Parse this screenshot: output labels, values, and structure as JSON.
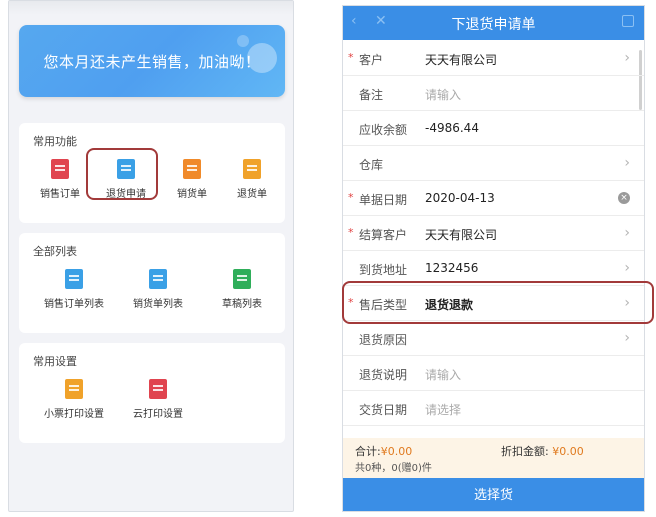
{
  "left": {
    "banner_text": "您本月还未产生销售，加油呦！",
    "sections": {
      "common_functions": {
        "title": "常用功能",
        "items": [
          {
            "label": "销售订单",
            "color": "#e0444f"
          },
          {
            "label": "退货申请",
            "color": "#3aa0e6"
          },
          {
            "label": "销货单",
            "color": "#f08a2a"
          },
          {
            "label": "退货单",
            "color": "#f0a22a"
          }
        ]
      },
      "all_lists": {
        "title": "全部列表",
        "items": [
          {
            "label": "销售订单列表",
            "color": "#3aa0e6"
          },
          {
            "label": "销货单列表",
            "color": "#3aa0e6"
          },
          {
            "label": "草稿列表",
            "color": "#2fae5a"
          }
        ]
      },
      "common_settings": {
        "title": "常用设置",
        "items": [
          {
            "label": "小票打印设置",
            "color": "#f0a22a"
          },
          {
            "label": "云打印设置",
            "color": "#e0444f"
          }
        ]
      }
    }
  },
  "right": {
    "header_title": "下退货申请单",
    "rows": [
      {
        "label": "客户",
        "value": "天天有限公司",
        "required": true,
        "placeholder": false,
        "trailing": "chevron"
      },
      {
        "label": "备注",
        "value": "请输入",
        "required": false,
        "placeholder": true,
        "trailing": ""
      },
      {
        "label": "应收余额",
        "value": "-4986.44",
        "required": false,
        "placeholder": false,
        "trailing": ""
      },
      {
        "label": "仓库",
        "value": "",
        "required": false,
        "placeholder": false,
        "trailing": "chevron"
      },
      {
        "label": "单据日期",
        "value": "2020-04-13",
        "required": true,
        "placeholder": false,
        "trailing": "clear"
      },
      {
        "label": "结算客户",
        "value": "天天有限公司",
        "required": true,
        "placeholder": false,
        "trailing": "chevron"
      },
      {
        "label": "到货地址",
        "value": "1232456",
        "required": false,
        "placeholder": false,
        "trailing": "chevron"
      },
      {
        "label": "售后类型",
        "value": "退货退款",
        "required": true,
        "placeholder": false,
        "trailing": "chevron"
      },
      {
        "label": "退货原因",
        "value": "",
        "required": false,
        "placeholder": false,
        "trailing": "chevron"
      },
      {
        "label": "退货说明",
        "value": "请输入",
        "required": false,
        "placeholder": true,
        "trailing": ""
      },
      {
        "label": "交货日期",
        "value": "请选择",
        "required": false,
        "placeholder": true,
        "trailing": ""
      }
    ],
    "summary": {
      "total_label": "合计:",
      "total_value": "¥0.00",
      "discount_label": "折扣金额:",
      "discount_value": "¥0.00",
      "count_text": "共0种，0(赠0)件"
    },
    "select_button": "选择货"
  }
}
